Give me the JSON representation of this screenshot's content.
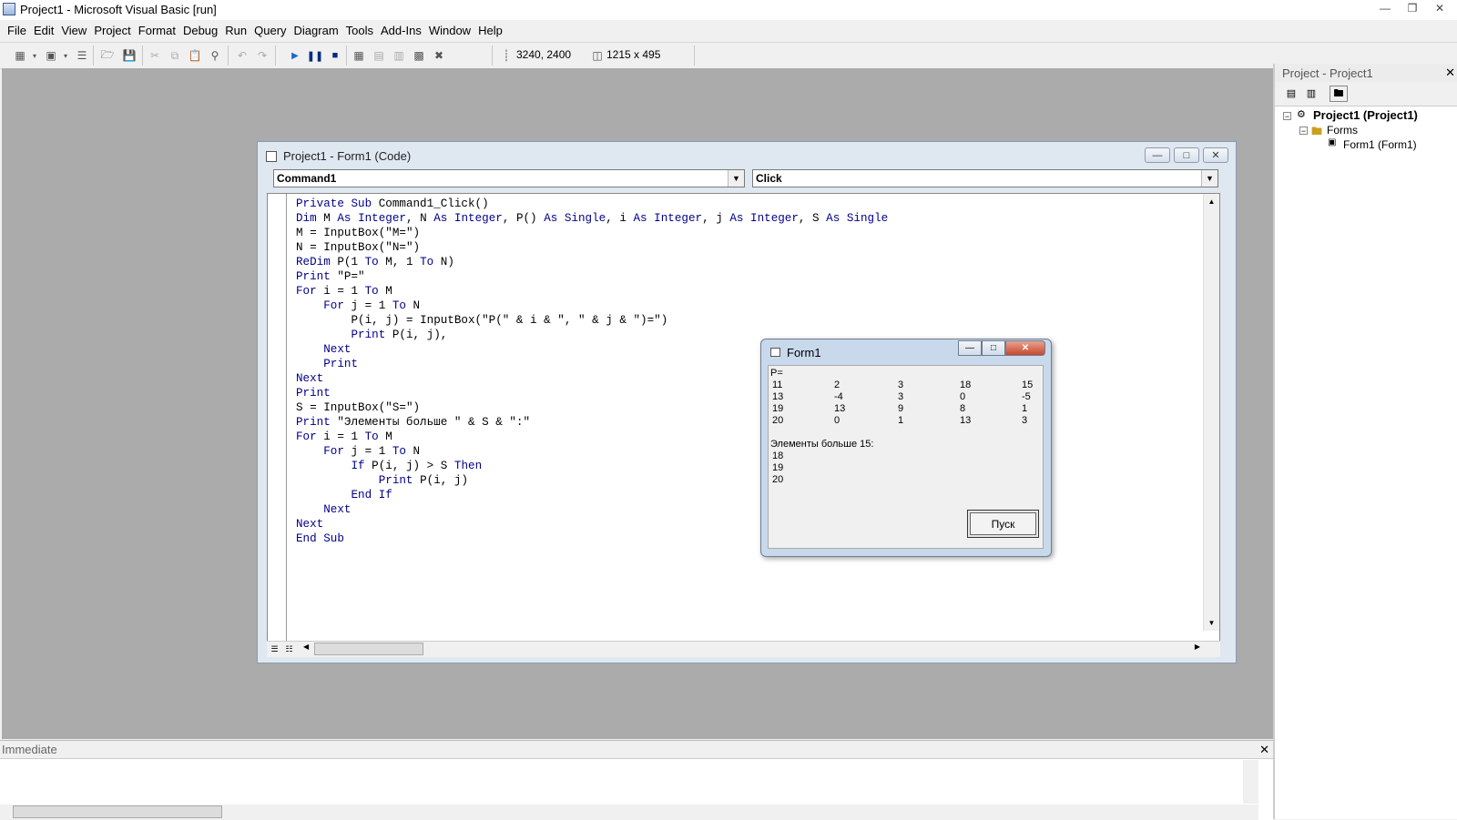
{
  "window": {
    "title": "Project1 - Microsoft Visual Basic [run]"
  },
  "menu": [
    "File",
    "Edit",
    "View",
    "Project",
    "Format",
    "Debug",
    "Run",
    "Query",
    "Diagram",
    "Tools",
    "Add-Ins",
    "Window",
    "Help"
  ],
  "toolbar": {
    "position": "3240, 2400",
    "size": "1215 x 495"
  },
  "code_window": {
    "title": "Project1 - Form1 (Code)",
    "object_combo": "Command1",
    "procedure_combo": "Click",
    "lines": [
      "Private Sub Command1_Click()",
      "Dim M As Integer, N As Integer, P() As Single, i As Integer, j As Integer, S As Single",
      "M = InputBox(\"M=\")",
      "N = InputBox(\"N=\")",
      "ReDim P(1 To M, 1 To N)",
      "Print \"P=\"",
      "For i = 1 To M",
      "    For j = 1 To N",
      "        P(i, j) = InputBox(\"P(\" & i & \", \" & j & \")=\")",
      "        Print P(i, j),",
      "    Next",
      "    Print",
      "Next",
      "Print",
      "S = InputBox(\"S=\")",
      "Print \"Элементы больше \" & S & \":\"",
      "For i = 1 To M",
      "    For j = 1 To N",
      "        If P(i, j) > S Then",
      "            Print P(i, j)",
      "        End If",
      "    Next",
      "Next",
      "End Sub"
    ]
  },
  "form1": {
    "title": "Form1",
    "matrix_label": "P=",
    "matrix": [
      [
        "11",
        "2",
        "3",
        "18",
        "15"
      ],
      [
        "13",
        "-4",
        "3",
        "0",
        "-5"
      ],
      [
        "19",
        "13",
        "9",
        "8",
        "1"
      ],
      [
        "20",
        "0",
        "1",
        "13",
        "3"
      ]
    ],
    "result_label": "Элементы больше 15:",
    "results": [
      "18",
      "19",
      "20"
    ],
    "button": "Пуск"
  },
  "project": {
    "title": "Project - Project1",
    "root": "Project1 (Project1)",
    "folder": "Forms",
    "item": "Form1 (Form1)"
  },
  "immediate": {
    "title": "Immediate"
  },
  "colors": {
    "keyword": "#00008b",
    "mdi_background": "#ababab"
  }
}
